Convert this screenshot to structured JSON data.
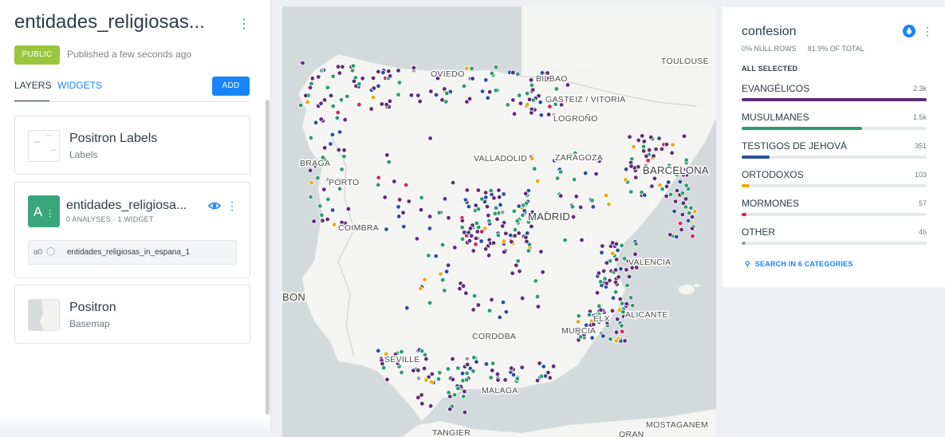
{
  "left_panel": {
    "map_title": "entidades_religiosas...",
    "status_badge": "PUBLIC",
    "published_text": "Published a few seconds ago",
    "tabs": [
      "LAYERS",
      "WIDGETS"
    ],
    "add_button": "ADD",
    "layers": [
      {
        "title": "Positron Labels",
        "subtitle": "Labels"
      },
      {
        "title": "entidades_religiosa...",
        "thumb_label": "A",
        "meta": "0 ANALYSES · 1 WIDGET",
        "analysis_id": "a0",
        "analysis_name": "entidades_religiosas_in_espana_1"
      },
      {
        "title": "Positron",
        "subtitle": "Basemap"
      }
    ]
  },
  "map": {
    "labels": [
      "TOULOUSE",
      "OVIEDO",
      "BILBAO",
      "GASTEIZ / VITORIA",
      "LOGROÑO",
      "BRAGA",
      "VALLADOLID",
      "ZARAGOZA",
      "BARCELONA",
      "PORTO",
      "MADRID",
      "COIMBRA",
      "VALENCIA",
      "BON",
      "ELX",
      "ALICANTE",
      "MURCIA",
      "CORDOBA",
      "SEVILLE",
      "MALAGA",
      "MOSTAGANEM",
      "TANGIER",
      "ORAN"
    ],
    "colors": {
      "water": "#d4dadc",
      "land": "#f4f4f2",
      "border": "#c9cdd0"
    }
  },
  "widget": {
    "title": "confesion",
    "null_rows": "0% NULL ROWS",
    "of_total": "81.9% OF TOTAL",
    "all_selected": "ALL SELECTED",
    "categories": [
      {
        "name": "EVANGÉLICOS",
        "value": "2.3k",
        "color": "#5d2e76",
        "fraction": 1.0
      },
      {
        "name": "MUSULMANES",
        "value": "1.5k",
        "color": "#2e9b6e",
        "fraction": 0.65
      },
      {
        "name": "TESTIGOS DE JEHOVÁ",
        "value": "351",
        "color": "#2d4f9c",
        "fraction": 0.15
      },
      {
        "name": "ORTODOXOS",
        "value": "103",
        "color": "#e6ae10",
        "fraction": 0.045
      },
      {
        "name": "MORMONES",
        "value": "57",
        "color": "#d6245d",
        "fraction": 0.025
      },
      {
        "name": "OTHER",
        "value": "46",
        "color": "#9aa1a4",
        "fraction": 0.02
      }
    ],
    "search_label": "SEARCH IN 6 CATEGORIES"
  }
}
